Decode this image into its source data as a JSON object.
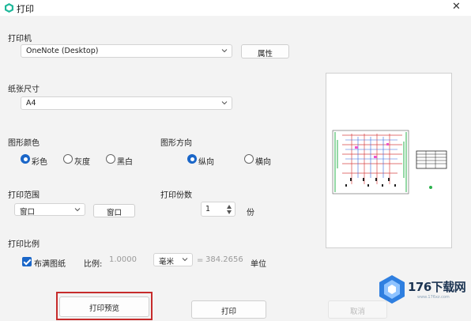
{
  "window": {
    "title": "打印",
    "close_icon": "close-icon"
  },
  "printer": {
    "label": "打印机",
    "selected": "OneNote (Desktop)",
    "properties_button": "属性"
  },
  "paper": {
    "label": "纸张尺寸",
    "selected": "A4"
  },
  "color": {
    "label": "图形颜色",
    "options": [
      "彩色",
      "灰度",
      "黑白"
    ],
    "selected": "彩色"
  },
  "orientation": {
    "label": "图形方向",
    "options": [
      "纵向",
      "横向"
    ],
    "selected": "纵向"
  },
  "range": {
    "label": "打印范围",
    "selected": "窗口",
    "window_button": "窗口"
  },
  "copies": {
    "label": "打印份数",
    "value": "1",
    "unit": "份"
  },
  "scale": {
    "label": "打印比例",
    "fit_checkbox": "布满图纸",
    "fit_checked": true,
    "ratio_label": "比例:",
    "ratio_value": "1.0000",
    "unit_selected": "毫米",
    "equals": "=",
    "units_value": "384.2656",
    "units_label": "单位"
  },
  "actions": {
    "preview": "打印预览",
    "print": "打印",
    "cancel": "取消"
  },
  "watermark": {
    "brand": "176下载网",
    "url": "www.176xz.com"
  },
  "colors": {
    "accent": "#1a66c8",
    "highlight": "#c62b2b"
  }
}
